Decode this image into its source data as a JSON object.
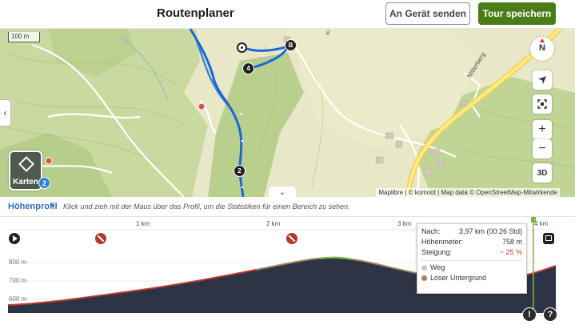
{
  "header": {
    "title": "Routenplaner",
    "send_label": "An Gerät senden",
    "save_label": "Tour speichern"
  },
  "map": {
    "scale_label": "100 m",
    "street_names": [
      "Mitterberg",
      "Ki"
    ],
    "waypoints": [
      "2",
      "4",
      "B"
    ],
    "maps_button_label": "Karten",
    "maps_badge_count": "2",
    "compass_label": "N",
    "controls": [
      "locate-icon",
      "fullscreen-icon",
      "zoom-in",
      "zoom-out",
      "3D"
    ],
    "zoom_in_label": "+",
    "zoom_out_label": "−",
    "threed_label": "3D",
    "attribution": "Maplibre | © komoot | Map data © OpenStreetMap-Mitwirkende",
    "route_color": "#1a67d9"
  },
  "profile": {
    "tab_label": "Höhenprofil",
    "hint": "Klick und zieh mit der Maus über das Profil, um die Statistiken für einen Bereich zu sehen.",
    "x_ticks": [
      "1 km",
      "2 km",
      "3 km",
      "4 km"
    ],
    "y_ticks": [
      "800 m",
      "700 m",
      "600 m"
    ],
    "tooltip": {
      "nach_label": "Nach:",
      "nach_value": "3,97 km (00:26 Std)",
      "hoehe_label": "Höhenmeter:",
      "hoehe_value": "758 m",
      "steigung_label": "Steigung:",
      "steigung_value": "~ 25 %",
      "legend_weg": "Weg",
      "legend_untergrund": "Loser Untergrund"
    },
    "warn_label": "!",
    "help_label": "?",
    "colors": {
      "fill": "#2c3445",
      "weg": "#c8c8c8",
      "untergrund": "#a0845a",
      "steep": "#c0392b",
      "marker": "#7ab648"
    }
  }
}
